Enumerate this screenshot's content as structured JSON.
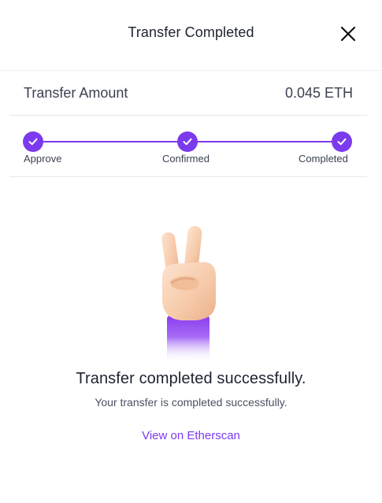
{
  "header": {
    "title": "Transfer Completed",
    "close_icon": "close-icon"
  },
  "transfer": {
    "amount_label": "Transfer Amount",
    "amount_value": "0.045 ETH"
  },
  "steps": [
    {
      "label": "Approve",
      "status": "completed"
    },
    {
      "label": "Confirmed",
      "status": "completed"
    },
    {
      "label": "Completed",
      "status": "completed"
    }
  ],
  "result": {
    "illustration": "victory-hand",
    "title": "Transfer completed successfully.",
    "subtitle": "Your transfer is completed successfully.",
    "link_label": "View on Etherscan"
  },
  "colors": {
    "accent": "#7c3aed",
    "text": "#1d2230",
    "divider": "#e6e8ec"
  }
}
